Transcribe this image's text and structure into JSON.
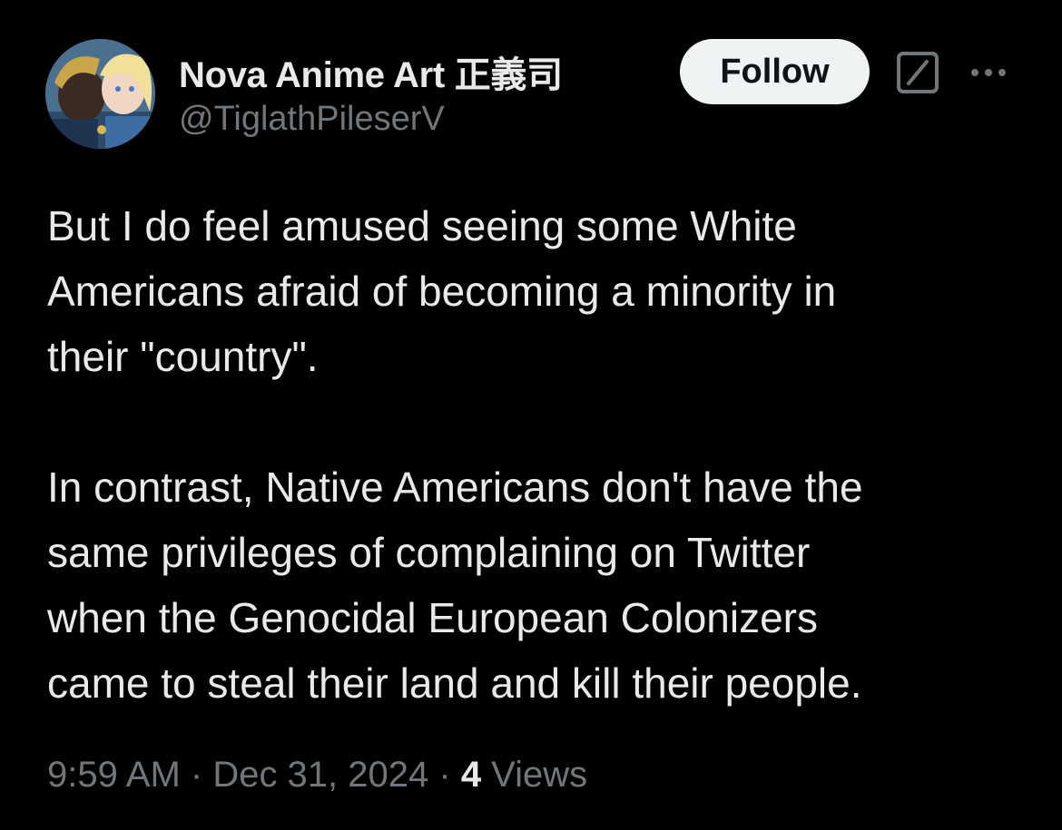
{
  "author": {
    "display_name": "Nova Anime Art 正義司",
    "handle": "@TiglathPileserV",
    "avatar": "avatar-icon"
  },
  "actions": {
    "follow_label": "Follow",
    "grok_icon": "grok-icon",
    "more_icon": "more-icon"
  },
  "body": {
    "paragraphs": [
      "But I do feel amused seeing some White\nAmericans afraid of becoming a minority in\ntheir \"country\".",
      "In contrast, Native Americans don't have the\nsame privileges of complaining on Twitter\nwhen the Genocidal European Colonizers\ncame to steal their land and kill their people."
    ]
  },
  "meta": {
    "time": "9:59 AM",
    "separator": " · ",
    "date": "Dec 31, 2024",
    "views_count": "4",
    "views_label": " Views"
  },
  "colors": {
    "background": "#000000",
    "primary_text": "#e7e9ea",
    "secondary_text": "#71767b",
    "follow_bg": "#eff3f4"
  }
}
